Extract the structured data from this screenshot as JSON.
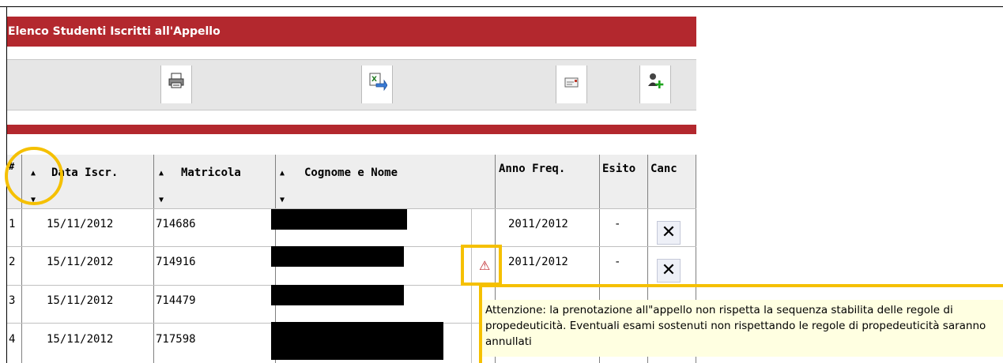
{
  "title": "Elenco Studenti Iscritti all'Appello",
  "toolbar": {
    "icons": [
      "printer-icon",
      "excel-export-icon",
      "email-icon",
      "add-user-icon"
    ]
  },
  "table": {
    "headers": {
      "num": "#",
      "data_iscr": "Data Iscr.",
      "matricola": "Matricola",
      "cognome_nome": "Cognome e Nome",
      "anno_freq": "Anno Freq.",
      "esito": "Esito",
      "canc": "Canc"
    },
    "sort_up": "▲",
    "sort_down": "▼",
    "rows": [
      {
        "num": "1",
        "data": "15/11/2012",
        "matricola": "714686",
        "anno": "2011/2012",
        "esito": "-",
        "canc": "✕"
      },
      {
        "num": "2",
        "data": "15/11/2012",
        "matricola": "714916",
        "anno": "2011/2012",
        "esito": "-",
        "canc": "✕"
      },
      {
        "num": "3",
        "data": "15/11/2012",
        "matricola": "714479"
      },
      {
        "num": "4",
        "data": "15/11/2012",
        "matricola": "717598"
      }
    ]
  },
  "warning_symbol": "⚠",
  "tooltip": {
    "text": "Attenzione: la prenotazione all\"appello non rispetta la sequenza stabilita delle regole di propedeuticità. Eventuali esami sostenuti non rispettando le regole di propedeuticità saranno annullati"
  },
  "colors": {
    "brand_red": "#b3282e",
    "highlight_yellow": "#f5c000",
    "tooltip_bg": "#ffffe1"
  }
}
